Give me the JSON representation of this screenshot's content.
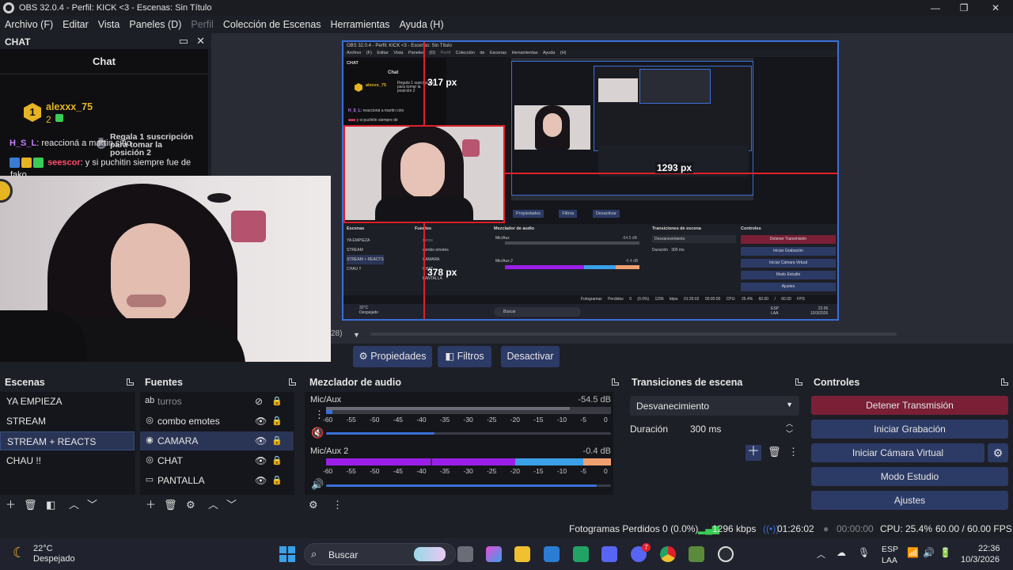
{
  "window": {
    "title": "OBS 32.0.4 - Perfil: KICK <3 - Escenas: Sin Título",
    "controls": [
      "—",
      "❐",
      "✕"
    ]
  },
  "menu": [
    "Archivo (F)",
    "Editar",
    "Vista",
    "Paneles (D)",
    "Perfil",
    "Colección de Escenas",
    "Herramientas",
    "Ayuda (H)"
  ],
  "chat_dock": {
    "title": "CHAT",
    "panel_title": "Chat",
    "gifter": {
      "rank": "1",
      "name": "alexxx_75",
      "count": "2"
    },
    "gift_rank": "2",
    "gift_text": "Regala 1 suscripción para tomar la posición 2",
    "messages": [
      {
        "user": "H_S_L",
        "text": ": reaccioná a martin cirio"
      },
      {
        "user": "seescor",
        "text": ": y si puchitin siempre fue de"
      },
      {
        "user": "",
        "text": "fako"
      }
    ]
  },
  "preview": {
    "overlay_labels": [
      "317 px",
      "1293 px",
      "378 px"
    ],
    "nested": {
      "menu": [
        "Archivo (F)",
        "Editar",
        "Vista",
        "Paneles (D)",
        "Perfil",
        "Colección de Escenas",
        "Herramientas",
        "Ayuda (H)"
      ],
      "title": "OBS 32.0.4 - Perfil: KICK <3 - Escenas: Sin Título",
      "docks": [
        "Escenas",
        "Fuentes",
        "Mezclador de audio",
        "Transiciones de escena",
        "Controles"
      ],
      "buttons": [
        "Propiedades",
        "Filtros",
        "Desactivar"
      ],
      "controls": [
        "Detener Transmisión",
        "Iniciar Grabación",
        "Iniciar Cámara Virtual",
        "Modo Estudio",
        "Ajustes"
      ],
      "scenes": [
        "YA EMPIEZA",
        "STREAM",
        "STREAM + REACTS",
        "CHAU !!"
      ],
      "sources": [
        "turros",
        "combo emotes",
        "CAMARA",
        "CHAT",
        "PANTALLA"
      ],
      "weather": "32°C",
      "weather_sub": "Despejado",
      "search": "Buscar",
      "mix1": "Mic/Aux",
      "mix1_db": "-54.5 dB",
      "mix2": "Mic/Aux 2",
      "mix2_db": "-0.4 dB",
      "transition": "Desvanecimiento",
      "duration_label": "Duración",
      "duration": "300 ms",
      "status": [
        "Fotogramas Perdidos 0 (0.0%)",
        "1296 kbps",
        "01:26:02",
        "00:00:00",
        "CPU: 25.4%",
        "60.00 / 60.00 FPS"
      ],
      "tray": [
        "ESP",
        "LAA",
        "22:36",
        "10/3/2026"
      ]
    },
    "side_text": "28)"
  },
  "props_bar": {
    "properties": "Propiedades",
    "filters": "Filtros",
    "deactivate": "Desactivar"
  },
  "scenes": {
    "title": "Escenas",
    "items": [
      "YA EMPIEZA",
      "STREAM",
      "STREAM + REACTS",
      "CHAU !!"
    ],
    "selected": "STREAM + REACTS"
  },
  "sources": {
    "title": "Fuentes",
    "items": [
      {
        "name": "turros",
        "icon": "text-icon",
        "glyph": "ab",
        "hidden": true
      },
      {
        "name": "combo emotes",
        "icon": "browser-icon",
        "glyph": "◎",
        "hidden": false
      },
      {
        "name": "CAMARA",
        "icon": "camera-icon",
        "glyph": "◉",
        "hidden": false
      },
      {
        "name": "CHAT",
        "icon": "browser-icon",
        "glyph": "◎",
        "hidden": false
      },
      {
        "name": "PANTALLA",
        "icon": "monitor-icon",
        "glyph": "▭",
        "hidden": false
      }
    ],
    "selected": "CAMARA"
  },
  "mixer": {
    "title": "Mezclador de audio",
    "channels": [
      {
        "name": "Mic/Aux",
        "db": "-54.5 dB",
        "muted": true,
        "volume": 0.38
      },
      {
        "name": "Mic/Aux 2",
        "db": "-0.4 dB",
        "muted": false,
        "volume": 0.95
      }
    ],
    "scale": [
      "-60",
      "-55",
      "-50",
      "-45",
      "-40",
      "-35",
      "-30",
      "-25",
      "-20",
      "-15",
      "-10",
      "-5",
      "0"
    ]
  },
  "transitions": {
    "title": "Transiciones de escena",
    "selected": "Desvanecimiento",
    "duration_label": "Duración",
    "duration": "300 ms"
  },
  "controls": {
    "title": "Controles",
    "stop_stream": "Detener Transmisión",
    "start_recording": "Iniciar Grabación",
    "start_virtualcam": "Iniciar Cámara Virtual",
    "studio_mode": "Modo Estudio",
    "settings": "Ajustes"
  },
  "status": {
    "dropped": "Fotogramas Perdidos 0 (0.0%)",
    "bitrate": "1296 kbps",
    "stream_time": "01:26:02",
    "rec_time": "00:00:00",
    "cpu": "CPU: 25.4%",
    "fps": "60.00 / 60.00 FPS"
  },
  "taskbar": {
    "weather_temp": "22°C",
    "weather_desc": "Despejado",
    "search_placeholder": "Buscar",
    "lang": "ESP",
    "lang2": "LAA",
    "time": "22:36",
    "date": "10/3/2026",
    "discord_badge": "7"
  },
  "colors": {
    "accent": "#2c3a66",
    "stop_stream": "#7a1f36",
    "selection_red": "#e0202a",
    "preview_border": "#3a6fd8",
    "meter_purple": "#9b1fe8",
    "meter_blue": "#3aa0e8",
    "meter_orange": "#f0a070"
  }
}
